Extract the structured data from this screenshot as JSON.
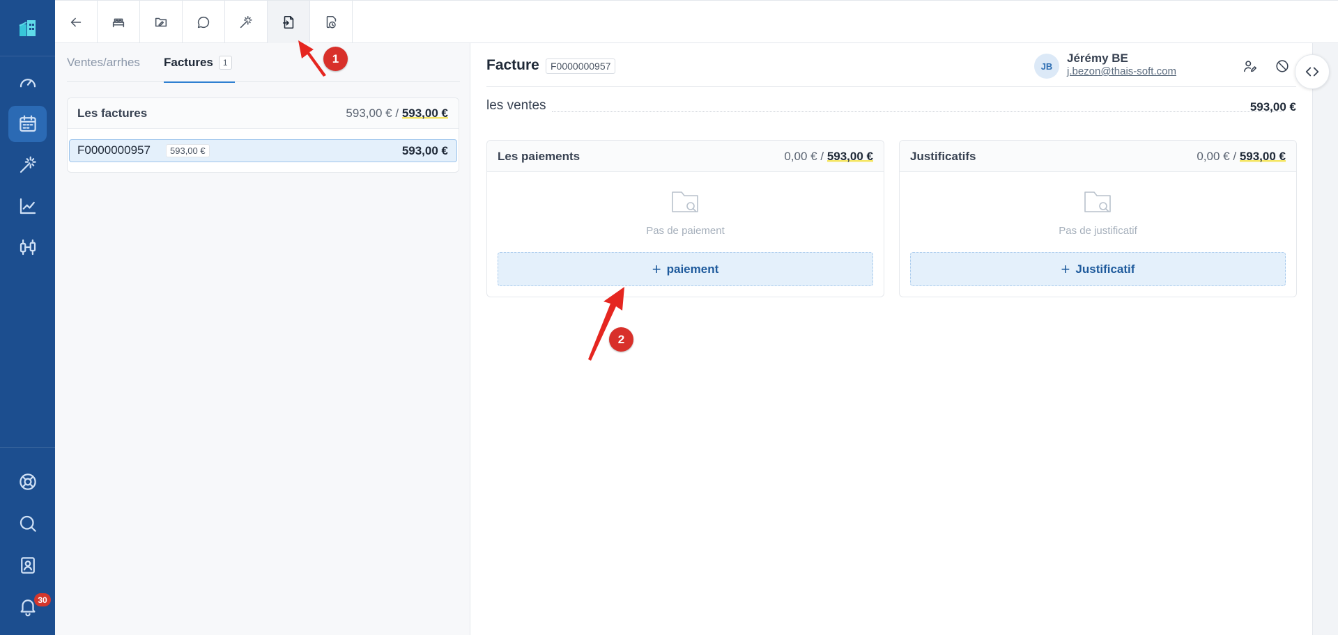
{
  "sidebar": {
    "items": [
      {
        "icon": "dashboard-gauge-icon"
      },
      {
        "icon": "calendar-icon",
        "active": true
      },
      {
        "icon": "magic-wand-icon"
      },
      {
        "icon": "line-chart-icon"
      },
      {
        "icon": "settings-sliders-icon"
      },
      {
        "icon": "lifebuoy-icon"
      },
      {
        "icon": "search-icon"
      },
      {
        "icon": "contact-card-icon"
      },
      {
        "icon": "bell-icon"
      }
    ],
    "notification_count": "30"
  },
  "toolbar": {
    "buttons": [
      {
        "icon": "back-arrow-icon"
      },
      {
        "icon": "bed-icon"
      },
      {
        "icon": "folder-edit-icon"
      },
      {
        "icon": "chat-bubble-icon"
      },
      {
        "icon": "magic-wand-icon"
      },
      {
        "icon": "invoice-add-icon",
        "active": true
      },
      {
        "icon": "document-clock-icon"
      }
    ]
  },
  "left_panel": {
    "tabs": [
      {
        "label": "Ventes/arrhes"
      },
      {
        "label": "Factures",
        "count": "1",
        "active": true
      }
    ],
    "invoices_card": {
      "title": "Les factures",
      "amount_paid": "593,00 €",
      "separator": "/",
      "amount_total": "593,00 €",
      "rows": [
        {
          "number": "F0000000957",
          "badge": "593,00 €",
          "amount": "593,00 €"
        }
      ]
    }
  },
  "detail": {
    "title": "Facture",
    "invoice_number": "F0000000957",
    "user": {
      "initials": "JB",
      "name": "Jérémy BE",
      "email": "j.bezon@thais-soft.com"
    },
    "ventes_label": "les ventes",
    "ventes_amount": "593,00 €",
    "payments": {
      "title": "Les paiements",
      "amount_done": "0,00 €",
      "separator": "/",
      "amount_total": "593,00 €",
      "empty_text": "Pas de paiement",
      "button_label": "paiement"
    },
    "justificatifs": {
      "title": "Justificatifs",
      "amount_done": "0,00 €",
      "separator": "/",
      "amount_total": "593,00 €",
      "empty_text": "Pas de justificatif",
      "button_label": "Justificatif"
    }
  },
  "annotations": [
    {
      "label": "1"
    },
    {
      "label": "2"
    }
  ],
  "colors": {
    "sidebar_bg": "#1c4e8f",
    "accent": "#2f80d1",
    "highlight_underline": "#f5e663",
    "annotation_red": "#d8302a"
  }
}
